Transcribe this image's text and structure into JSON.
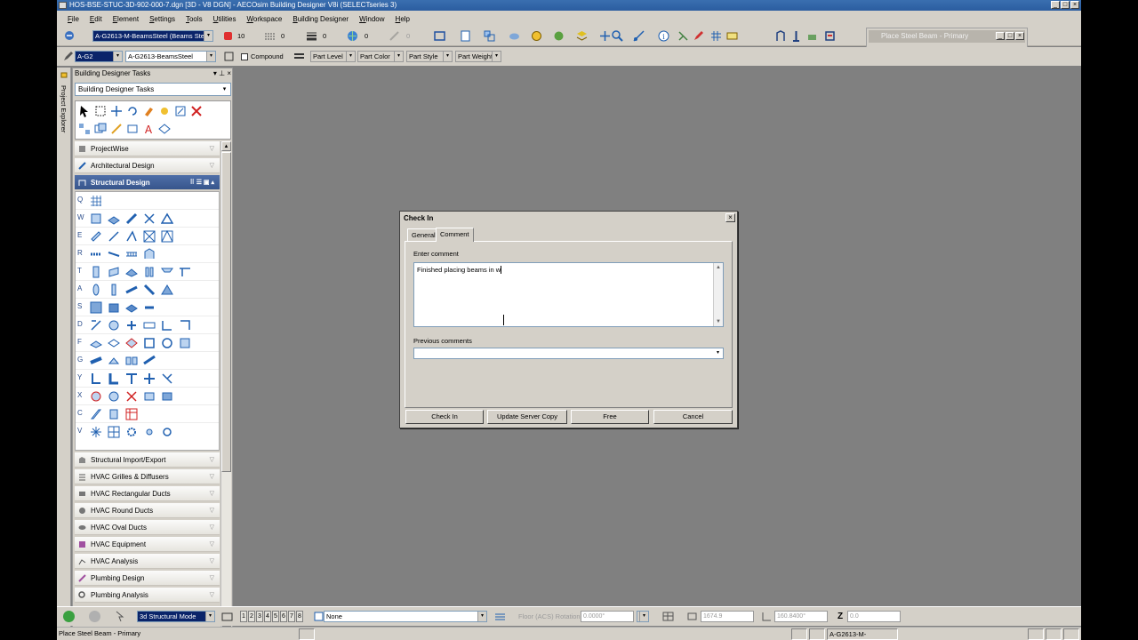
{
  "window": {
    "title": "HOS-BSE-STUC-3D-902-000-7.dgn [3D - V8 DGN] - AECOsim Building Designer V8i (SELECTseries 3)",
    "buttons": [
      "_",
      "□",
      "×"
    ]
  },
  "menu": [
    "File",
    "Edit",
    "Element",
    "Settings",
    "Tools",
    "Utilities",
    "Workspace",
    "Building Designer",
    "Window",
    "Help"
  ],
  "toolbar1": {
    "active_family": "A-G2613-M-BeamsSteel (Beams Steel",
    "color_value": "10",
    "style_value": "0",
    "weight_value": "0",
    "level_value": "0",
    "transparency_value": "0"
  },
  "toolbar2": {
    "level_combo": "A-G2",
    "family_combo": "A-G2613-BeamsSteel",
    "compound_label": "Compound",
    "part_level": "Part Level",
    "part_color": "Part Color",
    "part_style": "Part Style",
    "part_weight": "Part Weight"
  },
  "place_panel": {
    "title": "Place Steel Beam - Primary"
  },
  "sidestrip": {
    "label": "Project Explorer"
  },
  "task_panel": {
    "title": "Building Designer Tasks",
    "combo_value": "Building Designer Tasks",
    "categories_top": [
      "ProjectWise",
      "Architectural Design"
    ],
    "active_category": "Structural Design",
    "row_letters": [
      "Q",
      "W",
      "E",
      "R",
      "T",
      "A",
      "S",
      "D",
      "F",
      "G",
      "Y",
      "X",
      "C",
      "V"
    ],
    "categories_bottom": [
      "Structural Import/Export",
      "HVAC Grilles & Diffusers",
      "HVAC Rectangular Ducts",
      "HVAC Round Ducts",
      "HVAC Oval Ducts",
      "HVAC Equipment",
      "HVAC Analysis",
      "Plumbing Design",
      "Plumbing Analysis"
    ]
  },
  "dialog": {
    "title": "Check In",
    "tabs": [
      "General",
      "Comment"
    ],
    "active_tab": "Comment",
    "enter_comment_label": "Enter comment",
    "comment_text": "Finished placing beams in w",
    "previous_comments_label": "Previous comments",
    "previous_comments_value": "",
    "buttons": {
      "check_in": "Check In",
      "update_server_copy": "Update Server Copy",
      "free": "Free",
      "cancel": "Cancel"
    }
  },
  "bottom_toolbar": {
    "view_combo": "3d Structural Mode",
    "view_numbers": [
      "1",
      "2",
      "3",
      "4",
      "5",
      "6",
      "7",
      "8"
    ],
    "none_combo": "None",
    "floor_label": "Floor (ACS) Rotation",
    "rotation_value": "0.0000°",
    "length_value": "1674.9",
    "angle_value": "160.8400°",
    "z_label": "Z",
    "z_value": "0.0"
  },
  "statusbar": {
    "message": "Place Steel Beam - Primary",
    "active_level": "A-G2613-M-BeamsSteel"
  },
  "colors": {
    "title_bar": "#2b5da0",
    "chrome": "#d4d0c8",
    "workspace": "#808080",
    "active_category": "#37558c"
  }
}
